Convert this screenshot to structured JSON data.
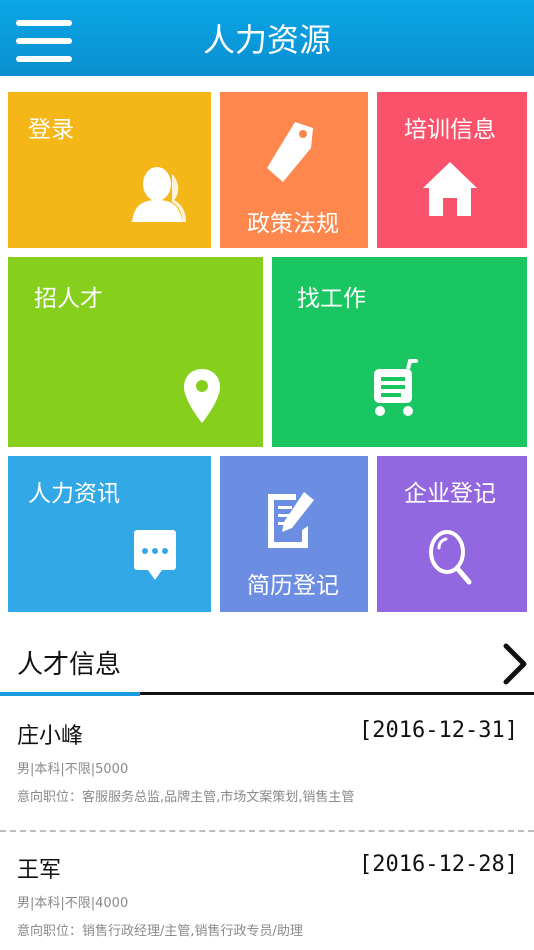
{
  "header": {
    "title": "人力资源"
  },
  "tiles": {
    "login": {
      "label": "登录",
      "color": "#f5b718",
      "icon": "user-icon"
    },
    "policy": {
      "label": "政策法规",
      "color": "#fd874c",
      "icon": "tag-icon"
    },
    "training": {
      "label": "培训信息",
      "color": "#fb526b",
      "icon": "home-icon"
    },
    "recruit": {
      "label": "招人才",
      "color": "#86cf1c",
      "icon": "location-pin-icon"
    },
    "job": {
      "label": "找工作",
      "color": "#19c662",
      "icon": "cart-icon"
    },
    "news": {
      "label": "人力资讯",
      "color": "#33a8e7",
      "icon": "chat-bubble-icon"
    },
    "resume": {
      "label": "简历登记",
      "color": "#6b8de2",
      "icon": "document-edit-icon"
    },
    "company": {
      "label": "企业登记",
      "color": "#9267df",
      "icon": "search-icon"
    }
  },
  "talent": {
    "title": "人才信息",
    "items": [
      {
        "name": "庄小峰",
        "date": "[2016-12-31]",
        "meta": "男|本科|不限|5000",
        "intent": "意向职位：客服服务总监,品牌主管,市场文案策划,销售主管"
      },
      {
        "name": "王军",
        "date": "[2016-12-28]",
        "meta": "男|本科|不限|4000",
        "intent": "意向职位：销售行政经理/主管,销售行政专员/助理"
      }
    ]
  }
}
